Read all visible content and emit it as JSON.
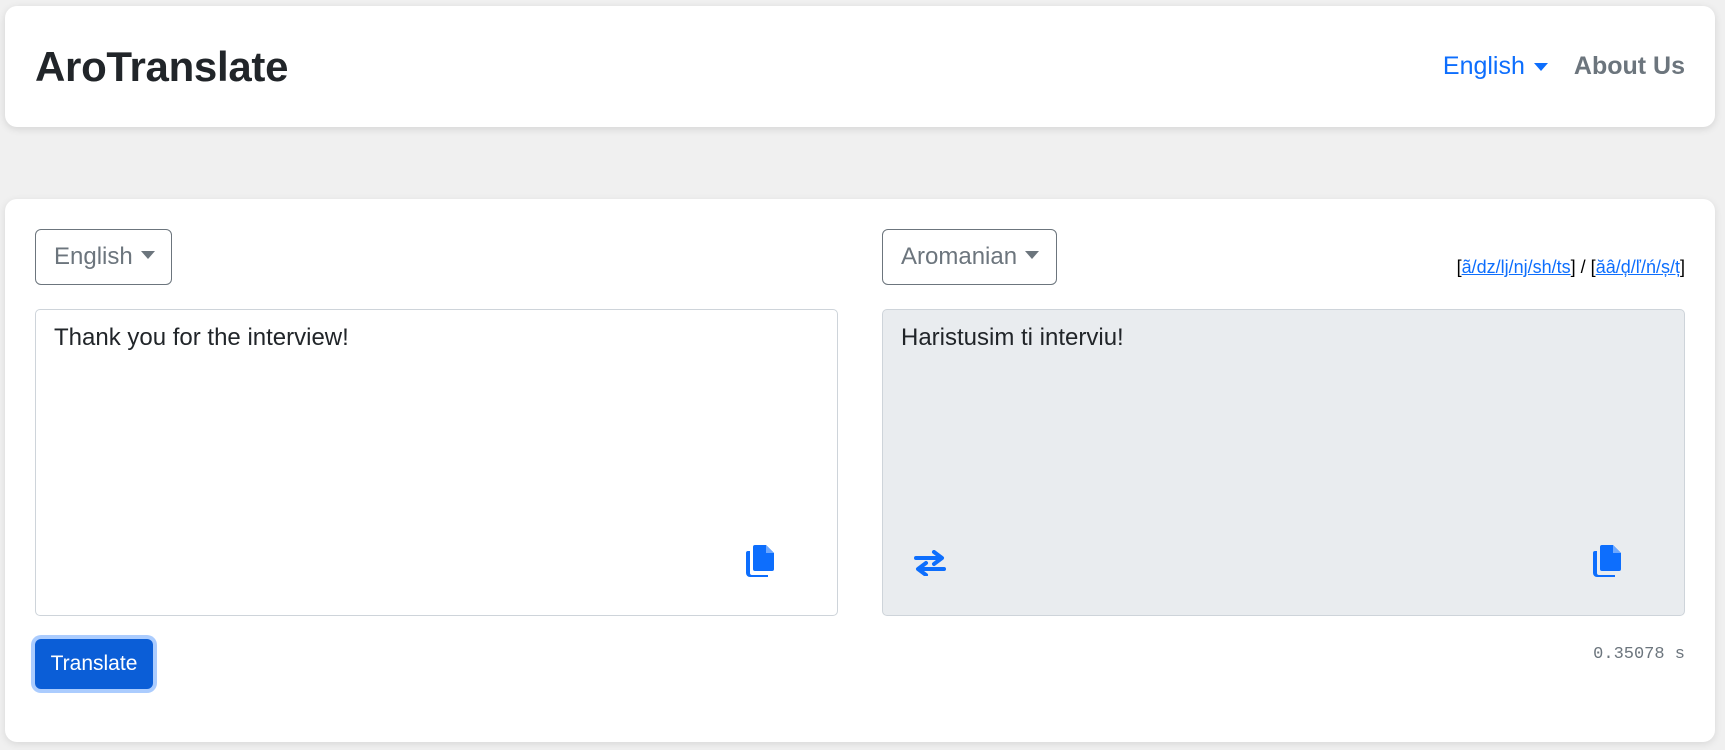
{
  "navbar": {
    "brand": "AroTranslate",
    "ui_language": "English",
    "about_label": "About Us"
  },
  "translator": {
    "source_language": "English",
    "target_language": "Aromanian",
    "charset": {
      "open1": "[",
      "link1": "ã/dz/lj/nj/sh/ts",
      "close1": "]",
      "separator": " / ",
      "open2": "[",
      "link2": "ăâ/ḑ/ľ/ń/ș/ț",
      "close2": "]"
    },
    "source_text": "Thank you for the interview!",
    "target_text": "Haristusim ti interviu!",
    "translate_label": "Translate",
    "elapsed_time": "0.35078 s"
  },
  "icons": {
    "copy_source": "copy-icon",
    "copy_target": "copy-icon",
    "swap": "swap-arrows-icon"
  },
  "colors": {
    "accent": "#0d6efd",
    "button_primary": "#0b5ed7",
    "muted": "#6c757d",
    "output_bg": "#e9ecef",
    "page_bg": "#f0f0f0"
  }
}
